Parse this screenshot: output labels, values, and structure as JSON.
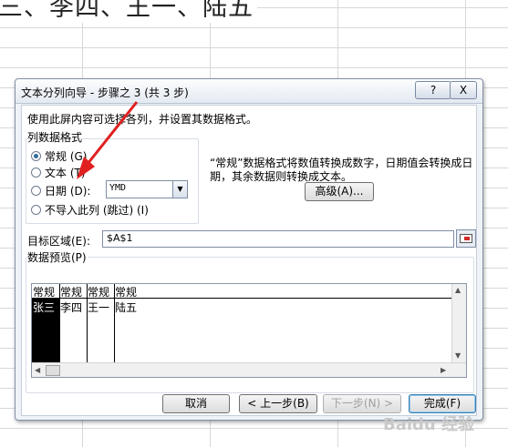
{
  "sheet": {
    "header_text": "三、李四、王一、陆五"
  },
  "dialog": {
    "title": "文本分列向导 - 步骤之 3 (共 3 步)",
    "help_label": "?",
    "close_label": "X",
    "description": "使用此屏内容可选择各列，并设置其数据格式。",
    "group_label": "列数据格式",
    "radios": [
      {
        "label": "常规 (G)",
        "checked": true
      },
      {
        "label": "文本 (T)",
        "checked": false
      },
      {
        "label": "日期 (D):",
        "checked": false
      },
      {
        "label": "不导入此列 (跳过) (I)",
        "checked": false
      }
    ],
    "date_format": "YMD",
    "hint": "“常规”数据格式将数值转换成数字，日期值会转换成日期，其余数据则转换成文本。",
    "advanced_label": "高级(A)...",
    "destination_label": "目标区域(E):",
    "destination_value": "$A$1",
    "preview_label": "数据预览(P)",
    "preview": {
      "headers": [
        "常规",
        "常规",
        "常规",
        "常规"
      ],
      "values": [
        "张三",
        "李四",
        "王一",
        "陆五"
      ]
    },
    "buttons": {
      "cancel": "取消",
      "back": "< 上一步(B)",
      "next": "下一步(N) >",
      "finish": "完成(F)"
    }
  },
  "watermark": "Baidu 经验",
  "colors": {
    "selected_column": "#000000",
    "annotation_arrow": "#e02020"
  }
}
